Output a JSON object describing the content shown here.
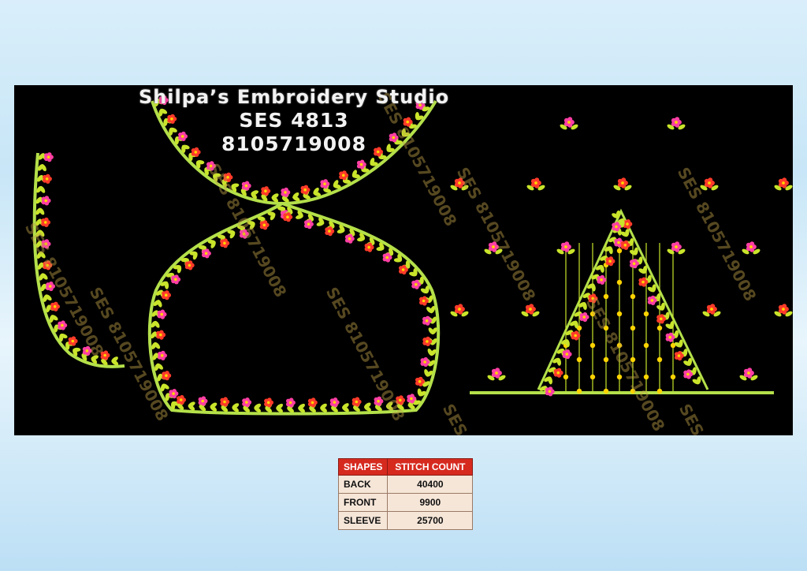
{
  "design": {
    "studio_name": "Shilpa’s Embroidery Studio",
    "design_code": "SES  4813",
    "phone": "8105719008",
    "watermark": "SES 8105719008",
    "colors": {
      "background": "#000000",
      "vine": "#b4e04a",
      "leaf": "#c9e42a",
      "flower_pink": "#ff3fa4",
      "flower_red": "#ff3b2a",
      "flower_center": "#ffd400"
    }
  },
  "stitch_table": {
    "headers": [
      "SHAPES",
      "STITCH COUNT"
    ],
    "rows": [
      {
        "shape": "BACK",
        "count": "40400"
      },
      {
        "shape": "FRONT",
        "count": "9900"
      },
      {
        "shape": "SLEEVE",
        "count": "25700"
      }
    ]
  }
}
